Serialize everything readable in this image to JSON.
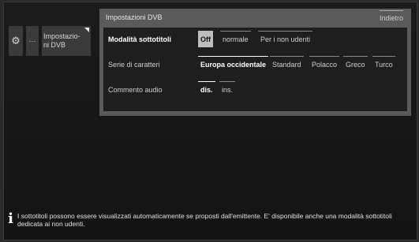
{
  "breadcrumb": {
    "settings_icon": "gear-icon",
    "more_label": "···",
    "current_label": "Impostazio-ni DVB"
  },
  "panel": {
    "title": "Impostazioni DVB",
    "back_label": "Indietro"
  },
  "settings": {
    "subtitles": {
      "label": "Modalità sottotitoli",
      "options": [
        "Off",
        "normale",
        "Per i non udenti"
      ],
      "selected": "Off"
    },
    "charset": {
      "label": "Serie di caratteri",
      "options": [
        "Europa occidentale",
        "Standard",
        "Polacco",
        "Greco",
        "Turco"
      ],
      "selected": "Europa occidentale"
    },
    "audio_commentary": {
      "label": "Commento audio",
      "options": [
        "dis.",
        "ins."
      ],
      "selected": "dis."
    }
  },
  "info": {
    "icon": "info-icon",
    "text": "I sottotitoli possono essere visualizzati automaticamente se proposti dall'emittente. E' disponibile anche una modalità sottotitoli dedicata ai non udenti."
  },
  "colors": {
    "background": "#141414",
    "panel": "#5a5a5a",
    "panel_body": "#1e1e1e",
    "active_option": "#bdbdbd"
  }
}
